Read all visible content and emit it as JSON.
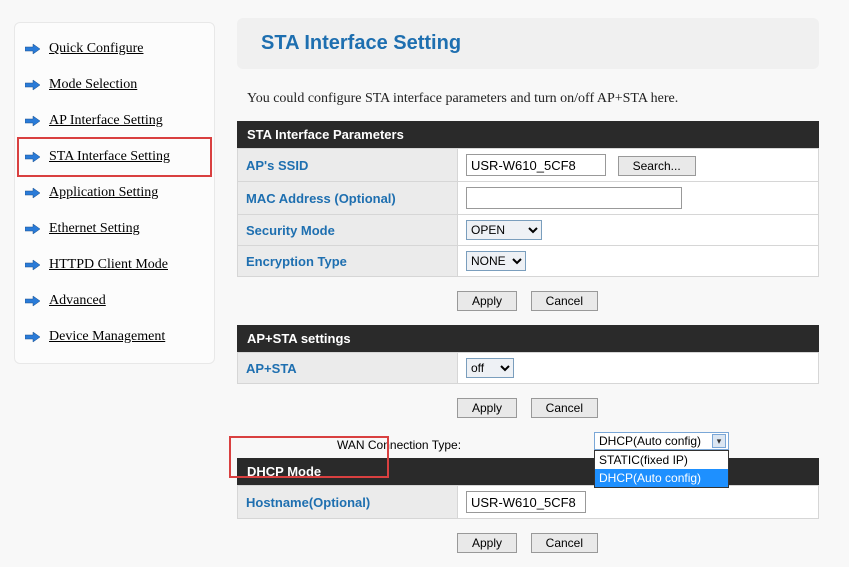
{
  "sidebar": {
    "items": [
      {
        "label": "Quick Configure"
      },
      {
        "label": "Mode Selection"
      },
      {
        "label": "AP Interface Setting"
      },
      {
        "label": "STA Interface Setting"
      },
      {
        "label": "Application Setting"
      },
      {
        "label": "Ethernet Setting"
      },
      {
        "label": "HTTPD Client Mode"
      },
      {
        "label": "Advanced"
      },
      {
        "label": "Device Management"
      }
    ],
    "selected_index": 3
  },
  "page": {
    "title": "STA Interface Setting",
    "description": "You could configure STA interface parameters and turn on/off AP+STA here."
  },
  "sta_params": {
    "header": "STA Interface Parameters",
    "rows": {
      "ssid_label": "AP's SSID",
      "ssid_value": "USR-W610_5CF8",
      "search_btn": "Search...",
      "mac_label": "MAC Address (Optional)",
      "mac_value": "",
      "sec_label": "Security Mode",
      "sec_value": "OPEN",
      "enc_label": "Encryption Type",
      "enc_value": "NONE"
    }
  },
  "apsta": {
    "header": "AP+STA settings",
    "label": "AP+STA",
    "value": "off"
  },
  "wan": {
    "label": "WAN Connection Type:",
    "selected": "DHCP(Auto config)",
    "options": [
      "STATIC(fixed IP)",
      "DHCP(Auto config)"
    ]
  },
  "dhcp": {
    "header": "DHCP Mode",
    "hostname_label": "Hostname(Optional)",
    "hostname_value": "USR-W610_5CF8"
  },
  "buttons": {
    "apply": "Apply",
    "cancel": "Cancel"
  }
}
